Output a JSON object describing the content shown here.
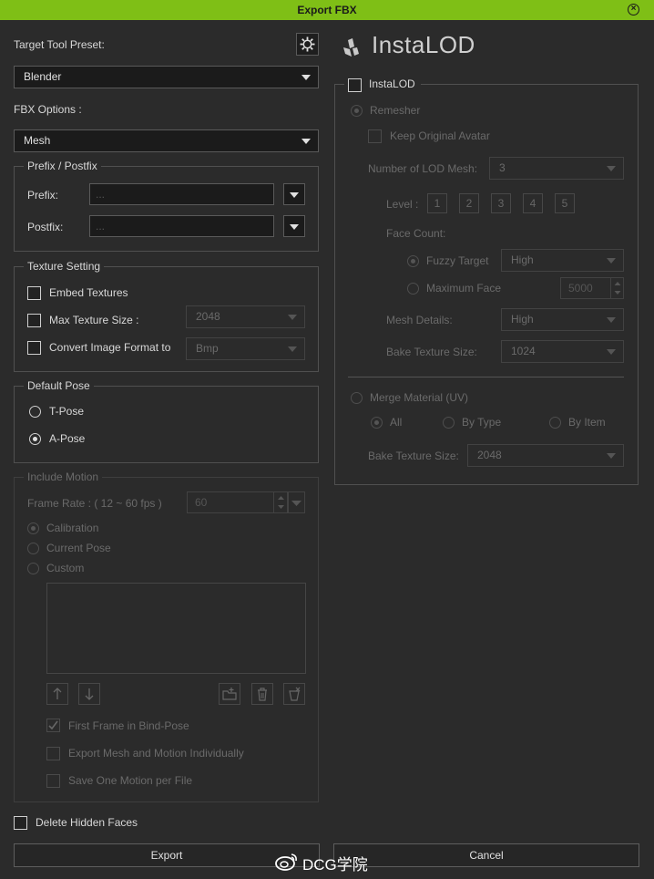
{
  "window": {
    "title": "Export FBX"
  },
  "left": {
    "target_tool_preset_label": "Target Tool Preset:",
    "target_tool_preset_value": "Blender",
    "fbx_options_label": "FBX Options :",
    "fbx_options_value": "Mesh",
    "prefix_postfix": {
      "title": "Prefix / Postfix",
      "prefix_label": "Prefix:",
      "prefix_value": "...",
      "postfix_label": "Postfix:",
      "postfix_value": "..."
    },
    "texture_setting": {
      "title": "Texture Setting",
      "embed_textures": "Embed Textures",
      "max_texture_size": "Max Texture Size :",
      "max_texture_size_value": "2048",
      "convert_image_format": "Convert Image Format to",
      "convert_image_format_value": "Bmp"
    },
    "default_pose": {
      "title": "Default Pose",
      "t_pose": "T-Pose",
      "a_pose": "A-Pose",
      "selected": "A-Pose"
    },
    "include_motion": {
      "title": "Include Motion",
      "frame_rate_label": "Frame Rate : ( 12 ~ 60 fps )",
      "frame_rate_value": "60",
      "calibration": "Calibration",
      "current_pose": "Current Pose",
      "custom": "Custom",
      "first_frame_bind_pose": "First Frame in Bind-Pose",
      "export_mesh_motion_individually": "Export Mesh and Motion Individually",
      "save_one_motion_per_file": "Save One Motion per File"
    },
    "delete_hidden_faces": "Delete Hidden Faces"
  },
  "right": {
    "logo_text": "InstaLOD",
    "instalod_checkbox": "InstaLOD",
    "remesher": "Remesher",
    "keep_original_avatar": "Keep Original Avatar",
    "number_of_lod_mesh_label": "Number of LOD Mesh:",
    "number_of_lod_mesh_value": "3",
    "level_label": "Level :",
    "levels": [
      "1",
      "2",
      "3",
      "4",
      "5"
    ],
    "face_count_label": "Face Count:",
    "fuzzy_target": "Fuzzy Target",
    "fuzzy_target_value": "High",
    "maximum_face": "Maximum Face",
    "maximum_face_value": "5000",
    "mesh_details_label": "Mesh Details:",
    "mesh_details_value": "High",
    "bake_texture_size_label": "Bake Texture Size:",
    "bake_texture_size_value": "1024",
    "merge_material": "Merge Material (UV)",
    "merge_all": "All",
    "merge_by_type": "By Type",
    "merge_by_item": "By Item",
    "merge_bake_texture_size_label": "Bake Texture Size:",
    "merge_bake_texture_size_value": "2048"
  },
  "footer": {
    "export_label": "Export",
    "cancel_label": "Cancel",
    "watermark": "DCG学院"
  }
}
